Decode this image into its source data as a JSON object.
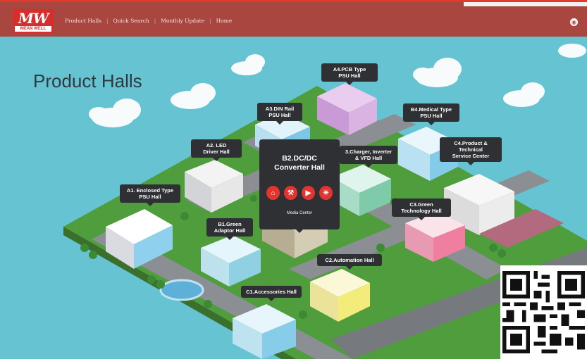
{
  "header": {
    "logo_text": "MW",
    "logo_subtext": "MEAN WELL",
    "nav": [
      "Product Halls",
      "Quick Search",
      "Monthly Update",
      "Home"
    ],
    "globe_icon": "globe-icon"
  },
  "page_title": "Product Halls",
  "halls": {
    "a4": "A4.PCB Type\nPSU Hall",
    "a3": "A3.DIN Rail\nPSU Hall",
    "b4": "B4.Medical Type\nPSU Hall",
    "a2": "A2. LED\nDriver Hall",
    "b2": "B2.DC/DC\nConverter Hall",
    "b3": "3.Charger, Inverter\n& VFD Hall",
    "c4": "C4.Product &\nTechnical\nService Center",
    "a1": "A1. Enclosed Type\nPSU Hall",
    "c3": "C3.Green\nTechnology Hall",
    "b1": "B1.Green\nAdaptor Hall",
    "c2": "C2.Automation Hall",
    "c1": "C1.Accessories Hall"
  },
  "media_center": "Media Center",
  "media_icons": [
    "home-icon",
    "tools-icon",
    "video-icon",
    "bulb-icon"
  ],
  "colors": {
    "header": "#a9463f",
    "accent": "#e3342f",
    "sky": "#66c3d2",
    "ground": "#4f9d3c",
    "road": "#8b8e93"
  }
}
